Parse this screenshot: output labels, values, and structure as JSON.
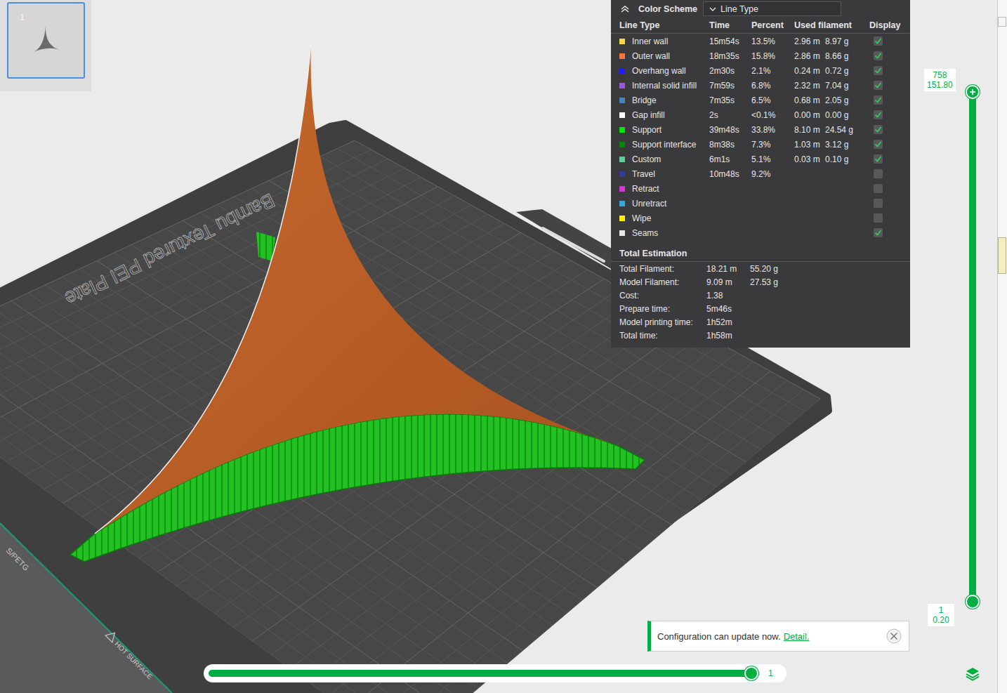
{
  "plates": [
    {
      "label": "1",
      "selected": true
    }
  ],
  "plate_labels": {
    "name": "Bambu Textured PEI Plate",
    "warning": "HOT SURFACE",
    "filament": "S/PETG"
  },
  "legend": {
    "title": "Color Scheme",
    "mode": "Line Type",
    "columns": [
      "Line Type",
      "Time",
      "Percent",
      "Used filament",
      "Display"
    ],
    "rows": [
      {
        "name": "Inner wall",
        "time": "15m54s",
        "percent": "13.5%",
        "length": "2.96 m",
        "weight": "8.97 g",
        "color": "#f7d93c",
        "displayed": true
      },
      {
        "name": "Outer wall",
        "time": "18m35s",
        "percent": "15.8%",
        "length": "2.86 m",
        "weight": "8.66 g",
        "color": "#f0783c",
        "displayed": true
      },
      {
        "name": "Overhang wall",
        "time": "2m30s",
        "percent": "2.1%",
        "length": "0.24 m",
        "weight": "0.72 g",
        "color": "#1e1ef0",
        "displayed": true
      },
      {
        "name": "Internal solid infill",
        "time": "7m59s",
        "percent": "6.8%",
        "length": "2.32 m",
        "weight": "7.04 g",
        "color": "#9b59d1",
        "displayed": true
      },
      {
        "name": "Bridge",
        "time": "7m35s",
        "percent": "6.5%",
        "length": "0.68 m",
        "weight": "2.05 g",
        "color": "#4a7fc0",
        "displayed": true
      },
      {
        "name": "Gap infill",
        "time": "2s",
        "percent": "<0.1%",
        "length": "0.00 m",
        "weight": "0.00 g",
        "color": "#ffffff",
        "displayed": true
      },
      {
        "name": "Support",
        "time": "39m48s",
        "percent": "33.8%",
        "length": "8.10 m",
        "weight": "24.54 g",
        "color": "#00e600",
        "displayed": true
      },
      {
        "name": "Support interface",
        "time": "8m38s",
        "percent": "7.3%",
        "length": "1.03 m",
        "weight": "3.12 g",
        "color": "#008a00",
        "displayed": true
      },
      {
        "name": "Custom",
        "time": "6m1s",
        "percent": "5.1%",
        "length": "0.03 m",
        "weight": "0.10 g",
        "color": "#5ecf9a",
        "displayed": true
      },
      {
        "name": "Travel",
        "time": "10m48s",
        "percent": "9.2%",
        "color": "#2f3d9b",
        "displayed": false
      },
      {
        "name": "Retract",
        "color": "#d338d3",
        "displayed": false
      },
      {
        "name": "Unretract",
        "color": "#36a8d9",
        "displayed": false
      },
      {
        "name": "Wipe",
        "color": "#ffee00",
        "displayed": false
      },
      {
        "name": "Seams",
        "color": "#e8e8e8",
        "displayed": true
      }
    ]
  },
  "total_estimation": {
    "title": "Total Estimation",
    "rows": [
      {
        "label": "Total Filament:",
        "values": [
          "18.21 m",
          "55.20 g"
        ]
      },
      {
        "label": "Model Filament:",
        "values": [
          "9.09 m",
          "27.53 g"
        ]
      },
      {
        "label": "Cost:",
        "values": [
          "1.38"
        ]
      },
      {
        "label": "Prepare time:",
        "values": [
          "5m46s"
        ]
      },
      {
        "label": "Model printing time:",
        "values": [
          "1h52m"
        ]
      },
      {
        "label": "Total time:",
        "values": [
          "1h58m"
        ]
      }
    ]
  },
  "layer_slider": {
    "top": {
      "layer": "758",
      "height": "151.80",
      "level": 1
    },
    "bottom": {
      "layer": "1",
      "height": "0.20",
      "level": 0
    }
  },
  "move_slider": {
    "value": "1",
    "level": 1
  },
  "notification": {
    "text": "Configuration can update now.",
    "link": "Detail."
  }
}
